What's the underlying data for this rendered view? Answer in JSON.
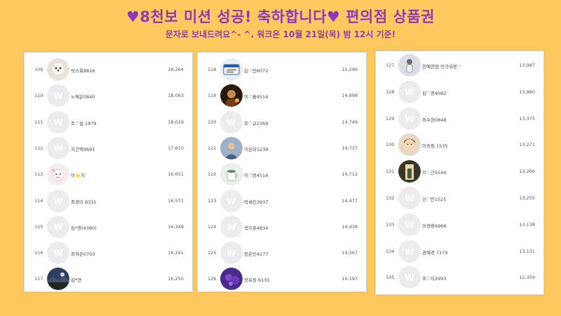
{
  "header": {
    "title": "♥8천보 미션 성공! 축하합니다♥ 편의점 상품권",
    "subtitle": "문자로 보내드려요^- ^. 워크온 10월 21일(목) 밤 12시 기준!"
  },
  "colors": {
    "background": "#fdc95e",
    "title": "#8a3cb5",
    "panel": "#ffffff",
    "default_avatar": "#ececee"
  },
  "rankings": [
    [
      {
        "rank": "109",
        "name": "박스회8816",
        "score": "18,264",
        "avatar": "dog-photo"
      },
      {
        "rank": "110",
        "name": "노채은0840",
        "score": "18,063",
        "avatar": "default-w"
      },
      {
        "rank": "111",
        "name": "조♡설 1879",
        "score": "18,029",
        "avatar": "default-w"
      },
      {
        "rank": "112",
        "name": "지근택9691",
        "score": "17,810",
        "avatar": "default-w"
      },
      {
        "rank": "113",
        "name": "이⭐지",
        "score": "16,651",
        "avatar": "cartoon"
      },
      {
        "rank": "114",
        "name": "최경미 8331",
        "score": "16,572",
        "avatar": "default-w"
      },
      {
        "rank": "115",
        "name": "김*영(4380)",
        "score": "16,348",
        "avatar": "default-w"
      },
      {
        "rank": "116",
        "name": "최하은0703",
        "score": "16,341",
        "avatar": "default-w"
      },
      {
        "rank": "117",
        "name": "김*연",
        "score": "16,250",
        "avatar": "landscape"
      }
    ],
    [
      {
        "rank": "118",
        "name": "김♡민6072",
        "score": "15,296",
        "avatar": "card"
      },
      {
        "rank": "119",
        "name": "이♡솔4514",
        "score": "14,898",
        "avatar": "dark-portrait"
      },
      {
        "rank": "120",
        "name": "조♡규2369",
        "score": "14,749",
        "avatar": "default-w"
      },
      {
        "rank": "121",
        "name": "이은미1239",
        "score": "14,737",
        "avatar": "person"
      },
      {
        "rank": "122",
        "name": "이♡성4514",
        "score": "14,712",
        "avatar": "mug"
      },
      {
        "rank": "123",
        "name": "박세진3937",
        "score": "14,477",
        "avatar": "default-w"
      },
      {
        "rank": "124",
        "name": "곽지훈4834",
        "score": "14,438",
        "avatar": "default-w"
      },
      {
        "rank": "125",
        "name": "전은빈4277",
        "score": "14,367",
        "avatar": "default-w"
      },
      {
        "rank": "126",
        "name": "장효원 6131",
        "score": "14,197",
        "avatar": "purple"
      }
    ],
    [
      {
        "rank": "127",
        "name": "전예전엄 빈가워용♡",
        "score": "13,987",
        "avatar": "figure"
      },
      {
        "rank": "128",
        "name": "김♡경4082",
        "score": "13,980",
        "avatar": "default-w"
      },
      {
        "rank": "129",
        "name": "최수현0848",
        "score": "13,375",
        "avatar": "default-w"
      },
      {
        "rank": "130",
        "name": "이송림 1535",
        "score": "13,271",
        "avatar": "girl"
      },
      {
        "rank": "131",
        "name": "지♡근5544",
        "score": "13,266",
        "avatar": "doorway"
      },
      {
        "rank": "132",
        "name": "신♡빈1525",
        "score": "13,255",
        "avatar": "default-w"
      },
      {
        "rank": "133",
        "name": "이경환6966",
        "score": "13,138",
        "avatar": "default-w"
      },
      {
        "rank": "134",
        "name": "권혜경 7174",
        "score": "13,131",
        "avatar": "default-w"
      },
      {
        "rank": "135",
        "name": "조♡지2993",
        "score": "12,359",
        "avatar": "default-w"
      }
    ]
  ]
}
